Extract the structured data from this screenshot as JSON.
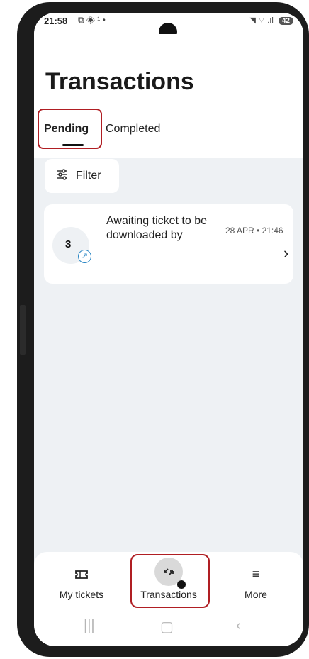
{
  "status_bar": {
    "time": "21:58",
    "left_icons": "⧉ ◈ ¹ •",
    "right_icons": "◥ ⌔ .ıl",
    "battery": "42"
  },
  "page": {
    "title": "Transactions"
  },
  "tabs": [
    {
      "label": "Pending",
      "selected": true
    },
    {
      "label": "Completed",
      "selected": false
    }
  ],
  "filter": {
    "label": "Filter",
    "icon": "sliders-icon"
  },
  "transactions": [
    {
      "count": "3",
      "text": "Awaiting ticket to be downloaded by",
      "date": "28 APR • 21:46",
      "icon": "outgoing-arrow-icon"
    }
  ],
  "bottom_nav": [
    {
      "label": "My tickets",
      "icon": "ticket-icon",
      "active": false
    },
    {
      "label": "Transactions",
      "icon": "transfer-arrows-icon",
      "active": true
    },
    {
      "label": "More",
      "icon": "menu-icon",
      "active": false
    }
  ],
  "colors": {
    "highlight": "#b01e23",
    "accent_blue": "#2a86c4",
    "background": "#eef1f4"
  }
}
